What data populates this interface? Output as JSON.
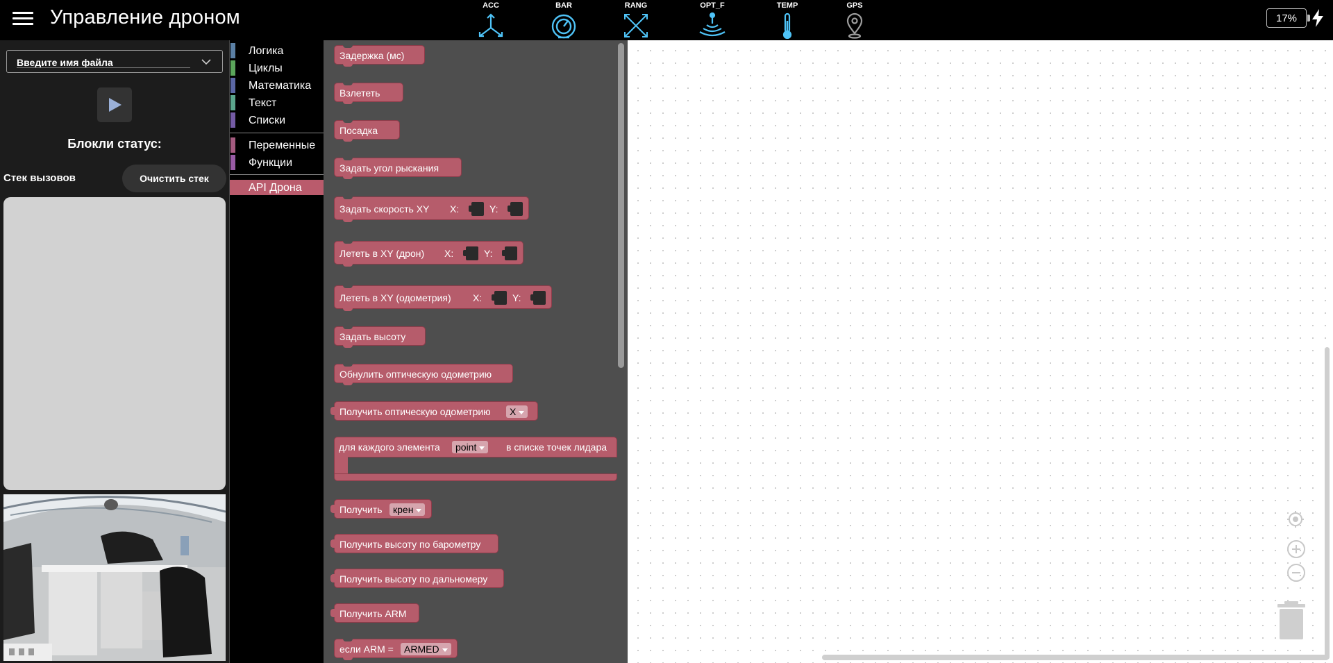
{
  "header": {
    "title": "Управление дроном",
    "sensors": [
      {
        "label": "ACC",
        "icon": "acc-arrows-icon"
      },
      {
        "label": "BAR",
        "icon": "barometer-gauge-icon"
      },
      {
        "label": "RANG",
        "icon": "range-arrows-icon"
      },
      {
        "label": "OPT_F",
        "icon": "optical-flow-waves-icon"
      },
      {
        "label": "TEMP",
        "icon": "thermometer-icon"
      },
      {
        "label": "GPS",
        "icon": "gps-pin-icon"
      }
    ],
    "battery": "17%",
    "accent_color": "#4fc3f7"
  },
  "left_panel": {
    "file_placeholder": "Введите имя файла",
    "status_title": "Блокли статус:",
    "stack_label": "Стек вызовов",
    "clear_button": "Очистить стек"
  },
  "toolbox": {
    "categories": [
      {
        "name": "Логика",
        "color": "#5b80a5"
      },
      {
        "name": "Циклы",
        "color": "#5ba55b"
      },
      {
        "name": "Математика",
        "color": "#5b67a5"
      },
      {
        "name": "Текст",
        "color": "#5ba58c"
      },
      {
        "name": "Списки",
        "color": "#745ba5"
      },
      {
        "name": "Переменные",
        "color": "#a55b80"
      },
      {
        "name": "Функции",
        "color": "#995ba5"
      },
      {
        "name": "API Дрона",
        "color": "#ba5b6c"
      }
    ]
  },
  "flyout": {
    "blocks": {
      "delay": "Задержка (мс)",
      "takeoff": "Взлететь",
      "land": "Посадка",
      "set_yaw": "Задать угол рыскания",
      "set_speed_xy": "Задать скорость XY",
      "fly_xy_drone": "Лететь в XY (дрон)",
      "fly_xy_odom": "Лететь в XY (одометрия)",
      "set_height": "Задать высоту",
      "reset_odom": "Обнулить оптическую одометрию",
      "get_odom": "Получить оптическую одометрию",
      "get_odom_axis": "X",
      "foreach_prefix": "для каждого элемента",
      "foreach_var": "point",
      "foreach_suffix": "в списке точек лидара",
      "get_prefix": "Получить",
      "get_angle": "крен",
      "get_baro": "Получить высоту по барометру",
      "get_range": "Получить высоту по дальномеру",
      "get_arm": "Получить ARM",
      "if_arm": "если ARM =",
      "if_arm_value": "ARMED"
    },
    "x_label": "X:",
    "y_label": "Y:",
    "block_color": "#b65c6b"
  }
}
